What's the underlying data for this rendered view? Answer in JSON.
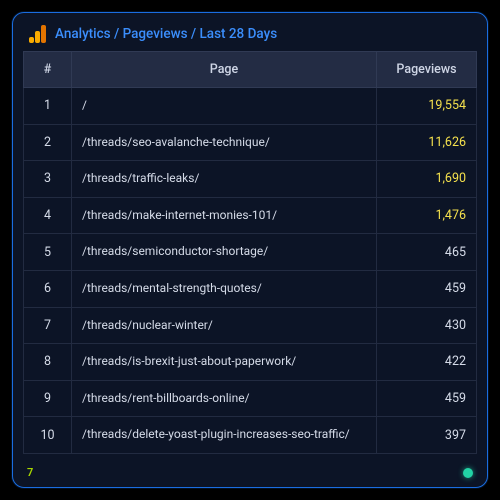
{
  "header": {
    "breadcrumb": "Analytics / Pageviews / Last 28 Days"
  },
  "columns": {
    "rank": "#",
    "page": "Page",
    "views": "Pageviews"
  },
  "rows": [
    {
      "rank": "1",
      "page": "/",
      "views": "19,554",
      "highlight": true
    },
    {
      "rank": "2",
      "page": "/threads/seo-avalanche-technique/",
      "views": "11,626",
      "highlight": true
    },
    {
      "rank": "3",
      "page": "/threads/traffic-leaks/",
      "views": "1,690",
      "highlight": true
    },
    {
      "rank": "4",
      "page": "/threads/make-internet-monies-101/",
      "views": "1,476",
      "highlight": true
    },
    {
      "rank": "5",
      "page": "/threads/semiconductor-shortage/",
      "views": "465",
      "highlight": false
    },
    {
      "rank": "6",
      "page": "/threads/mental-strength-quotes/",
      "views": "459",
      "highlight": false
    },
    {
      "rank": "7",
      "page": "/threads/nuclear-winter/",
      "views": "430",
      "highlight": false
    },
    {
      "rank": "8",
      "page": "/threads/is-brexit-just-about-paperwork/",
      "views": "422",
      "highlight": false
    },
    {
      "rank": "9",
      "page": "/threads/rent-billboards-online/",
      "views": "459",
      "highlight": false
    },
    {
      "rank": "10",
      "page": "/threads/delete-yoast-plugin-increases-seo-traffic/",
      "views": "397",
      "highlight": false
    }
  ],
  "footer": {
    "page_number": "7"
  }
}
